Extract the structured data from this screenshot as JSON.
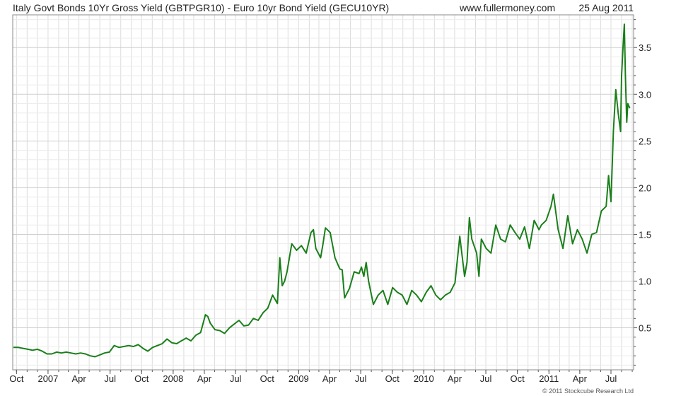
{
  "header": {
    "title": "Italy Govt Bonds 10Yr Gross Yield (GBTPGR10) - Euro 10yr Bond Yield (GECU10YR)",
    "website": "www.fullermoney.com",
    "date": "25 Aug 2011"
  },
  "footer": {
    "credit": "© 2011 Stockcube Research Ltd"
  },
  "colors": {
    "line": "#1a7f1a",
    "grid": "#dcdcdc",
    "axis": "#555555"
  },
  "chart_data": {
    "type": "line",
    "title": "Italy Govt Bonds 10Yr Gross Yield (GBTPGR10) - Euro 10yr Bond Yield (GECU10YR)",
    "xlabel": "",
    "ylabel": "",
    "xlim": [
      "2006-09-20",
      "2011-09-05"
    ],
    "ylim": [
      0.05,
      3.85
    ],
    "grid": true,
    "y_axis_position": "right",
    "x_tick_labels": [
      "Oct",
      "2007",
      "Apr",
      "Jul",
      "Oct",
      "2008",
      "Apr",
      "Jul",
      "Oct",
      "2009",
      "Apr",
      "Jul",
      "Oct",
      "2010",
      "Apr",
      "Jul",
      "Oct",
      "2011",
      "Apr",
      "Jul"
    ],
    "x_tick_dates": [
      "2006-10-01",
      "2007-01-01",
      "2007-04-01",
      "2007-07-01",
      "2007-10-01",
      "2008-01-01",
      "2008-04-01",
      "2008-07-01",
      "2008-10-01",
      "2009-01-01",
      "2009-04-01",
      "2009-07-01",
      "2009-10-01",
      "2010-01-01",
      "2010-04-01",
      "2010-07-01",
      "2010-10-01",
      "2011-01-01",
      "2011-04-01",
      "2011-07-01"
    ],
    "y_ticks": [
      0.5,
      1.0,
      1.5,
      2.0,
      2.5,
      3.0,
      3.5
    ],
    "y_tick_labels": [
      "0.5",
      "1.0",
      "1.5",
      "2.0",
      "2.5",
      "3.0",
      "3.5"
    ],
    "series": [
      {
        "x": [
          "2006-09-22",
          "2006-10-06",
          "2006-10-20",
          "2006-11-03",
          "2006-11-17",
          "2006-12-01",
          "2006-12-15",
          "2006-12-29",
          "2007-01-12",
          "2007-01-26",
          "2007-02-09",
          "2007-02-23",
          "2007-03-09",
          "2007-03-23",
          "2007-04-06",
          "2007-04-20",
          "2007-05-04",
          "2007-05-18",
          "2007-06-01",
          "2007-06-15",
          "2007-06-29",
          "2007-07-13",
          "2007-07-27",
          "2007-08-10",
          "2007-08-24",
          "2007-09-07",
          "2007-09-21",
          "2007-10-05",
          "2007-10-19",
          "2007-11-02",
          "2007-11-16",
          "2007-11-30",
          "2007-12-14",
          "2007-12-28",
          "2008-01-11",
          "2008-01-25",
          "2008-02-08",
          "2008-02-22",
          "2008-03-07",
          "2008-03-21",
          "2008-04-04",
          "2008-04-11",
          "2008-04-18",
          "2008-05-02",
          "2008-05-16",
          "2008-05-30",
          "2008-06-13",
          "2008-06-27",
          "2008-07-11",
          "2008-07-25",
          "2008-08-08",
          "2008-08-22",
          "2008-09-05",
          "2008-09-19",
          "2008-10-03",
          "2008-10-17",
          "2008-10-31",
          "2008-11-07",
          "2008-11-14",
          "2008-11-21",
          "2008-11-28",
          "2008-12-12",
          "2008-12-26",
          "2009-01-09",
          "2009-01-23",
          "2009-02-06",
          "2009-02-13",
          "2009-02-20",
          "2009-03-06",
          "2009-03-13",
          "2009-03-20",
          "2009-04-03",
          "2009-04-17",
          "2009-05-01",
          "2009-05-08",
          "2009-05-15",
          "2009-05-29",
          "2009-06-12",
          "2009-06-26",
          "2009-07-03",
          "2009-07-10",
          "2009-07-17",
          "2009-07-24",
          "2009-08-07",
          "2009-08-21",
          "2009-09-04",
          "2009-09-18",
          "2009-10-02",
          "2009-10-16",
          "2009-10-30",
          "2009-11-13",
          "2009-11-27",
          "2009-12-11",
          "2009-12-25",
          "2010-01-08",
          "2010-01-22",
          "2010-02-05",
          "2010-02-19",
          "2010-03-05",
          "2010-03-19",
          "2010-04-02",
          "2010-04-16",
          "2010-04-30",
          "2010-05-07",
          "2010-05-14",
          "2010-05-21",
          "2010-06-04",
          "2010-06-11",
          "2010-06-18",
          "2010-07-02",
          "2010-07-16",
          "2010-07-30",
          "2010-08-13",
          "2010-08-27",
          "2010-09-10",
          "2010-09-24",
          "2010-10-08",
          "2010-10-22",
          "2010-11-05",
          "2010-11-19",
          "2010-12-03",
          "2010-12-10",
          "2010-12-24",
          "2011-01-07",
          "2011-01-14",
          "2011-01-28",
          "2011-02-11",
          "2011-02-25",
          "2011-03-11",
          "2011-03-25",
          "2011-04-08",
          "2011-04-22",
          "2011-05-06",
          "2011-05-20",
          "2011-06-03",
          "2011-06-17",
          "2011-06-24",
          "2011-07-01",
          "2011-07-08",
          "2011-07-15",
          "2011-07-22",
          "2011-07-29",
          "2011-08-01",
          "2011-08-05",
          "2011-08-09",
          "2011-08-12",
          "2011-08-16",
          "2011-08-19",
          "2011-08-25"
        ],
        "y": [
          0.29,
          0.29,
          0.28,
          0.27,
          0.26,
          0.27,
          0.25,
          0.22,
          0.22,
          0.24,
          0.23,
          0.24,
          0.23,
          0.22,
          0.23,
          0.22,
          0.2,
          0.19,
          0.21,
          0.23,
          0.24,
          0.31,
          0.29,
          0.3,
          0.31,
          0.3,
          0.32,
          0.28,
          0.25,
          0.29,
          0.31,
          0.33,
          0.38,
          0.34,
          0.33,
          0.36,
          0.39,
          0.36,
          0.42,
          0.45,
          0.64,
          0.62,
          0.55,
          0.48,
          0.47,
          0.44,
          0.5,
          0.54,
          0.58,
          0.52,
          0.53,
          0.6,
          0.58,
          0.66,
          0.71,
          0.85,
          0.76,
          1.25,
          0.95,
          1.0,
          1.1,
          1.4,
          1.33,
          1.38,
          1.3,
          1.52,
          1.55,
          1.35,
          1.25,
          1.4,
          1.57,
          1.52,
          1.25,
          1.13,
          1.12,
          0.82,
          0.92,
          1.1,
          1.08,
          1.15,
          1.05,
          1.2,
          1.0,
          0.75,
          0.85,
          0.9,
          0.75,
          0.93,
          0.88,
          0.85,
          0.75,
          0.9,
          0.85,
          0.78,
          0.88,
          0.95,
          0.85,
          0.8,
          0.85,
          0.88,
          0.98,
          1.48,
          1.05,
          1.2,
          1.68,
          1.45,
          1.3,
          1.05,
          1.45,
          1.35,
          1.3,
          1.6,
          1.45,
          1.42,
          1.6,
          1.52,
          1.45,
          1.58,
          1.35,
          1.65,
          1.55,
          1.6,
          1.65,
          1.8,
          1.93,
          1.55,
          1.35,
          1.7,
          1.4,
          1.55,
          1.45,
          1.3,
          1.5,
          1.52,
          1.75,
          1.8,
          2.13,
          1.85,
          2.6,
          3.05,
          2.8,
          2.6,
          3.2,
          3.5,
          3.75,
          3.2,
          2.7,
          2.9,
          2.85
        ]
      }
    ]
  }
}
